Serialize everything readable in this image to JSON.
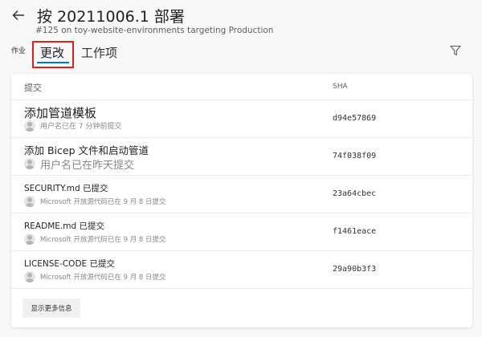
{
  "header": {
    "title": "按 20211006.1 部署",
    "subtitle": "#125 on toy-website-environments targeting Production"
  },
  "tabs": {
    "group_label": "作业",
    "items": [
      {
        "label": "更改",
        "selected": true
      },
      {
        "label": "工作项",
        "selected": false
      }
    ]
  },
  "table": {
    "columns": {
      "commit": "提交",
      "sha": "SHA"
    },
    "rows": [
      {
        "message": "添加管道模板",
        "meta": "用户名已在 7 分钟前提交",
        "sha": "d94e57869"
      },
      {
        "message": "添加 Bicep 文件和启动管道",
        "meta": "用户名已在昨天提交",
        "sha": "74f038f09"
      },
      {
        "message": "SECURITY.md 已提交",
        "meta": "Microsoft 开放源代码已在 9 月 8 日提交",
        "sha": "23a64cbec"
      },
      {
        "message": "README.md 已提交",
        "meta": "Microsoft 开放源代码已在 9 月 8 日提交",
        "sha": "f1461eace"
      },
      {
        "message": "LICENSE-CODE 已提交",
        "meta": "Microsoft 开放源代码已在 9 月 8 日提交",
        "sha": "29a90b3f3"
      }
    ]
  },
  "actions": {
    "show_more": "显示更多信息"
  },
  "colors": {
    "accent": "#0078d4",
    "highlight": "#e02020"
  }
}
